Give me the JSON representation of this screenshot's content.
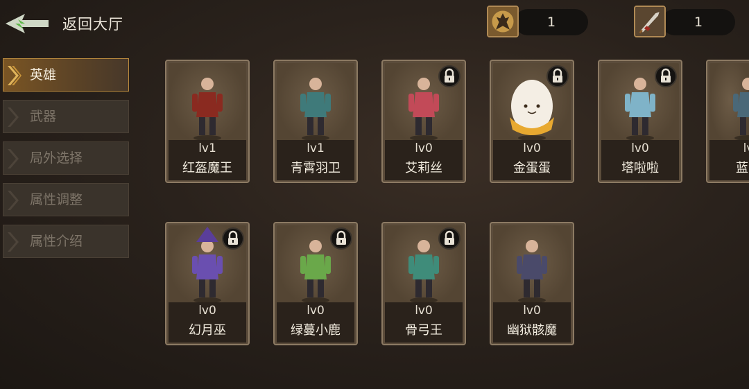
{
  "header": {
    "back_label": "返回大厅",
    "resources": [
      {
        "icon": "warrior-portrait-icon",
        "count": "1"
      },
      {
        "icon": "sword-icon",
        "count": "1"
      }
    ]
  },
  "tabs": [
    {
      "label": "英雄",
      "active": true
    },
    {
      "label": "武器",
      "active": false
    },
    {
      "label": "局外选择",
      "active": false
    },
    {
      "label": "属性调整",
      "active": false
    },
    {
      "label": "属性介绍",
      "active": false
    }
  ],
  "heroes": [
    {
      "level": "lv1",
      "name": "红盔魔王",
      "locked": false,
      "color": "#8a2a20"
    },
    {
      "level": "lv1",
      "name": "青霄羽卫",
      "locked": false,
      "color": "#3f7a7a"
    },
    {
      "level": "lv0",
      "name": "艾莉丝",
      "locked": true,
      "color": "#c24a58"
    },
    {
      "level": "lv0",
      "name": "金蛋蛋",
      "locked": true,
      "color": "#f0e8dc"
    },
    {
      "level": "lv0",
      "name": "塔啦啦",
      "locked": true,
      "color": "#7fb3c8"
    },
    {
      "level": "lv",
      "name": "蓝鬃",
      "locked": false,
      "color": "#4a6878"
    },
    {
      "level": "lv0",
      "name": "幻月巫",
      "locked": true,
      "color": "#6a4fb0"
    },
    {
      "level": "lv0",
      "name": "绿蔓小鹿",
      "locked": true,
      "color": "#6aa84a"
    },
    {
      "level": "lv0",
      "name": "骨弓王",
      "locked": true,
      "color": "#3f8c7a"
    },
    {
      "level": "lv0",
      "name": "幽狱骸魔",
      "locked": false,
      "color": "#4a4a6a"
    }
  ]
}
